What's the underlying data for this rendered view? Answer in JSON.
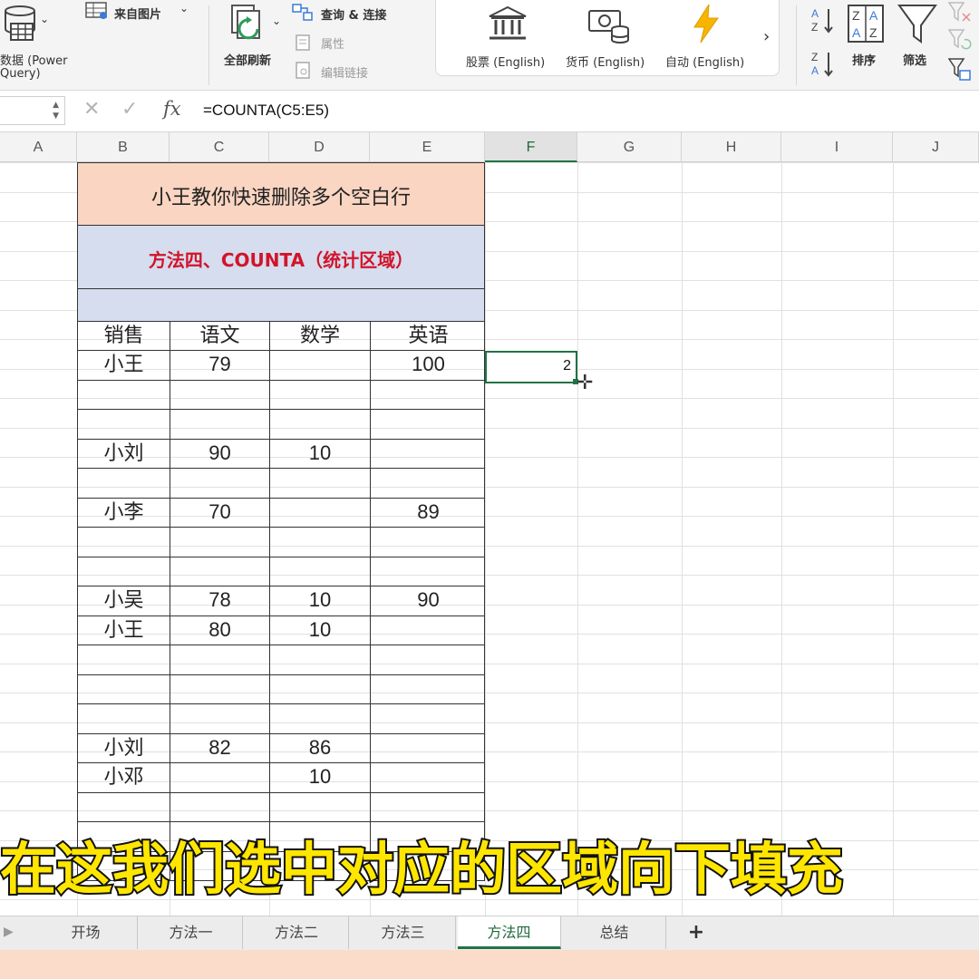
{
  "ribbon": {
    "data_label_line1": "数据 (Power",
    "data_label_line2": "Query)",
    "from_picture": "来自图片",
    "refresh_all": "全部刷新",
    "queries_connections": "查询 & 连接",
    "properties": "属性",
    "edit_links": "编辑链接",
    "stocks": "股票 (English)",
    "currency": "货币 (English)",
    "auto": "自动 (English)",
    "sort": "排序",
    "filter": "筛选"
  },
  "formula_bar": {
    "fx_label": "fx",
    "formula": "=COUNTA(C5:E5)"
  },
  "columns": [
    "A",
    "B",
    "C",
    "D",
    "E",
    "F",
    "G",
    "H",
    "I",
    "J"
  ],
  "sheet": {
    "title": "小王教你快速删除多个空白行",
    "method": "方法四、COUNTA（统计区域）",
    "headers": [
      "销售",
      "语文",
      "数学",
      "英语"
    ],
    "rows": [
      [
        "小王",
        "79",
        "",
        "100"
      ],
      [
        "",
        "",
        "",
        ""
      ],
      [
        "",
        "",
        "",
        ""
      ],
      [
        "小刘",
        "90",
        "10",
        ""
      ],
      [
        "",
        "",
        "",
        ""
      ],
      [
        "小李",
        "70",
        "",
        "89"
      ],
      [
        "",
        "",
        "",
        ""
      ],
      [
        "",
        "",
        "",
        ""
      ],
      [
        "小吴",
        "78",
        "10",
        "90"
      ],
      [
        "小王",
        "80",
        "10",
        ""
      ],
      [
        "",
        "",
        "",
        ""
      ],
      [
        "",
        "",
        "",
        ""
      ],
      [
        "",
        "",
        "",
        ""
      ],
      [
        "小刘",
        "82",
        "86",
        ""
      ],
      [
        "小邓",
        "",
        "10",
        ""
      ],
      [
        "",
        "",
        "",
        ""
      ],
      [
        "",
        "",
        "",
        ""
      ],
      [
        "",
        "",
        "",
        ""
      ]
    ],
    "selected_value": "2"
  },
  "subtitle": "在这我们选中对应的区域向下填充",
  "tabs": {
    "items": [
      "开场",
      "方法一",
      "方法二",
      "方法三",
      "方法四",
      "总结"
    ],
    "active": "方法四",
    "add": "+"
  },
  "colors": {
    "title_fill": "#f9d5c2",
    "method_fill": "#d5ddee",
    "method_text": "#d2142a",
    "excel_green": "#217346",
    "subtitle_text": "#ffe600"
  }
}
